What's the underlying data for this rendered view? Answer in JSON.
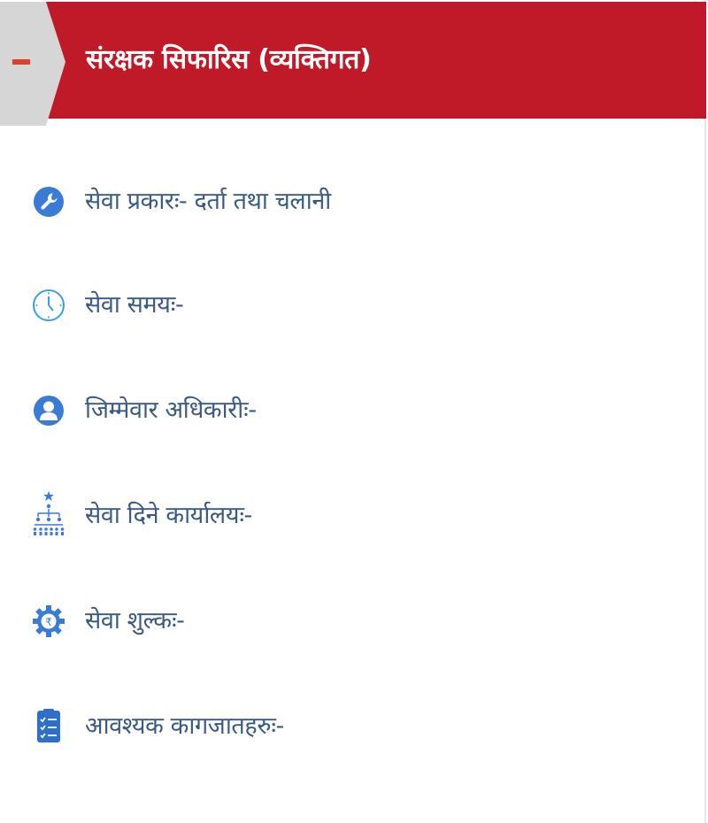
{
  "header": {
    "title": "संरक्षक सिफारिस (व्यक्तिगत)",
    "toggle_icon": "minus-icon",
    "accent_color": "#c01927"
  },
  "items": [
    {
      "icon": "wrench-icon",
      "label": "सेवा प्रकारः- दर्ता तथा चलानी"
    },
    {
      "icon": "clock-icon",
      "label": "सेवा समयः-"
    },
    {
      "icon": "user-icon",
      "label": "जिम्मेवार अधिकारीः-"
    },
    {
      "icon": "org-chart-icon",
      "label": "सेवा दिने कार्यालयः-"
    },
    {
      "icon": "rupee-gear-icon",
      "label": "सेवा शुल्कः-"
    },
    {
      "icon": "checklist-icon",
      "label": "आवश्यक कागजातहरुः-"
    }
  ],
  "colors": {
    "icon_blue": "#3a7bd5",
    "text_blue": "#3b5a82"
  }
}
